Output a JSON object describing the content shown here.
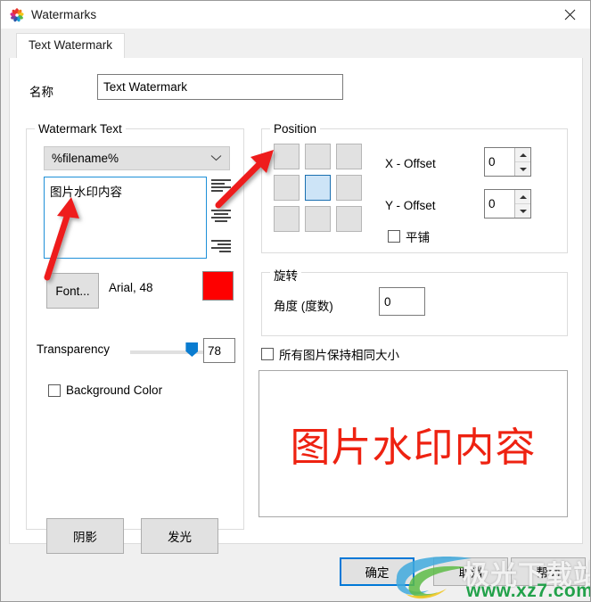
{
  "window": {
    "title": "Watermarks",
    "app_icon": "pinwheel-icon",
    "close_label": "✕"
  },
  "tabs": [
    {
      "label": "Text Watermark",
      "active": true
    }
  ],
  "name_row": {
    "label": "名称",
    "value": "Text Watermark"
  },
  "watermark_text": {
    "legend": "Watermark Text",
    "placeholder_select": {
      "value": "%filename%",
      "chevron": "⌄"
    },
    "text_value": "图片水印内容",
    "align_icons": [
      "align-left-icon",
      "align-center-icon",
      "align-right-icon"
    ],
    "font_button": "Font...",
    "font_info": "Arial, 48",
    "color_swatch": "#fe0000",
    "transparency": {
      "label": "Transparency",
      "value": "78",
      "percent": 78
    },
    "background_color": {
      "label": "Background Color",
      "checked": false
    },
    "shadow_button": "阴影",
    "glow_button": "发光"
  },
  "position": {
    "legend": "Position",
    "grid": [
      {
        "name": "top-left",
        "selected": false
      },
      {
        "name": "top-center",
        "selected": false
      },
      {
        "name": "top-right",
        "selected": false
      },
      {
        "name": "middle-left",
        "selected": false
      },
      {
        "name": "middle-center",
        "selected": true
      },
      {
        "name": "middle-right",
        "selected": false
      },
      {
        "name": "bottom-left",
        "selected": false
      },
      {
        "name": "bottom-center",
        "selected": false
      },
      {
        "name": "bottom-right",
        "selected": false
      }
    ],
    "x_offset": {
      "label": "X - Offset",
      "value": "0"
    },
    "y_offset": {
      "label": "Y - Offset",
      "value": "0"
    },
    "tile": {
      "label": "平铺",
      "checked": false
    }
  },
  "rotation": {
    "legend": "旋转",
    "angle": {
      "label": "角度 (度数)",
      "value": "0"
    }
  },
  "same_size": {
    "label": "所有图片保持相同大小",
    "checked": false
  },
  "preview": {
    "text": "图片水印内容",
    "text_color": "#ee2211",
    "glow_color": "#f5e24a"
  },
  "footer": {
    "ok": "确定",
    "cancel": "取消",
    "help": "帮助"
  },
  "site_watermark": {
    "title": "极光下载站",
    "url": "www.xz7.com",
    "title_color": "#f2f2f2",
    "url_color": "#22a14a"
  }
}
